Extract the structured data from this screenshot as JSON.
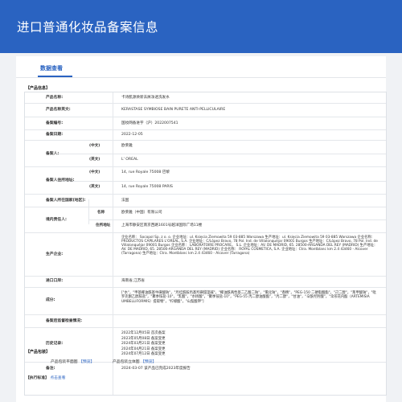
{
  "header": {
    "title": "进口普通化妆品备案信息"
  },
  "tab": {
    "label": "数据查看"
  },
  "sections": {
    "product_info": "【产品信息】",
    "product_images": "【产品包装】",
    "exec_standard": "【执行标准】"
  },
  "product": {
    "name_cn_label": "产品名称:",
    "name_cn": "卡诗肌源焕新去屑净透洗发水",
    "name_en_label": "产品名称英文:",
    "name_en": "KERASTASE SYMBIOSE BAIN PURETE ANTI-PELLICULAIRE",
    "filing_no_label": "备案编号:",
    "filing_no": "国妆网备进字（沪）2022007541",
    "filing_date_label": "备案日期:",
    "filing_date": "2022-12-05",
    "filer_label": "备案人:",
    "cn_label": "(中文)",
    "en_label": "(英文)",
    "filer_cn": "欧莱雅",
    "filer_en": "L' OREAL",
    "filer_addr_label": "备案人住所地址:",
    "filer_addr_cn": "14, rue Royale 75008 巴黎",
    "filer_addr_en": "14, rue Royale 75008 PARIS",
    "country_label": "备案人所在国家(地区):",
    "country": "法国",
    "agent_label": "境内责任人:",
    "agent_name_label": "名称",
    "agent_name": "欧莱雅（中国）有限公司",
    "agent_addr_label": "住所地址",
    "agent_addr": "上海市静安区南京西路1601号越洋国际广场11楼",
    "producer_label": "生产企业:",
    "producer": "企业名称： Socopol Sp. z o. o. 企业地址：ul. Księcia Ziemowita 59 03-885 Warszawa 生产地址：ul. Księcia Ziemowita 59 03-885 Warszawa 企业名称： PRODUCTOS CAPILARES L'OREAL, S.A. 企业地址：C/López Bravo, 78 Pol. Ind. de Villalonquéjar 09001 Burgos 生产地址：C/López Bravo, 78 Pol. Ind. de Villalonquéjar 09001 Burgos 企业名称： LABORATOIRE PROCARE， S.L. 企业地址：AV. DE MADRID, 65. 28500-ARGANDA DEL REY (MADRID) 生产地址：AV. DE MADRID, 65. 28500-ARGANDA DEL REY (MADRID) 企业名称： ROYAL COSMETICA, S.A. 企业地址：Ctra. Montblanc km 2.4 43460 - Alcover (Tarragona) 生产地址：Ctra. Montblanc km 2.4 43460 - Alcover (Tarragona)",
    "port_label": "进口口岸:",
    "port": "海南省,江苏省",
    "ingredients_label": "成分:",
    "ingredients": "[\"水\"，\"甲基椰油酰基牛磺酸钠\"，\"月桂酰胺丙基羟磺甜菜碱\"，\"椰油酰两性基二乙酸二钠\"，\"氯化钠\"，\"香精\"，\"PEG-150 二硬脂酸酯\"，\"己二醇\"，\"苯甲酸钠\"，\"吡罗克酮乙醇胺盐\"，\"聚季铵盐-10\"，\"乳酸\"，\"水杨酸\"，\"聚季铵盐-10\"，\"PEG-55 丙二醇油酸酯\"，\"丙二醇\"，\"甘油\"，\"辛酰羟肟酸\"，\"伞形花内酯（ARTEMISIA UMBELLIFORMIS）提取物\"，\"柠檬酸\"，\"山梨酸钾\"]",
    "postmarket_label": "备案后监督检查情况:",
    "postmarket": "",
    "history_label": "历史记录:",
    "history": [
      "2022年12月05日 首次备案",
      "2023年05月08日 备案变更",
      "2024年03月21日 备案变更",
      "2024年04月21日 备案变更",
      "2024年07月12日 备案变更"
    ],
    "remark_label": "备注:",
    "remark": "2024-03-07 该产品已完成2023年度报告"
  },
  "images": {
    "flat_label": "产品包装平面图",
    "flat_link": "【预览】",
    "stereo_label": "产品包装立体图",
    "stereo_link": "【预览】"
  },
  "standard": {
    "link": "点击查看"
  },
  "colors": {
    "brand": "#2a63c1",
    "link": "#2a63c1"
  }
}
